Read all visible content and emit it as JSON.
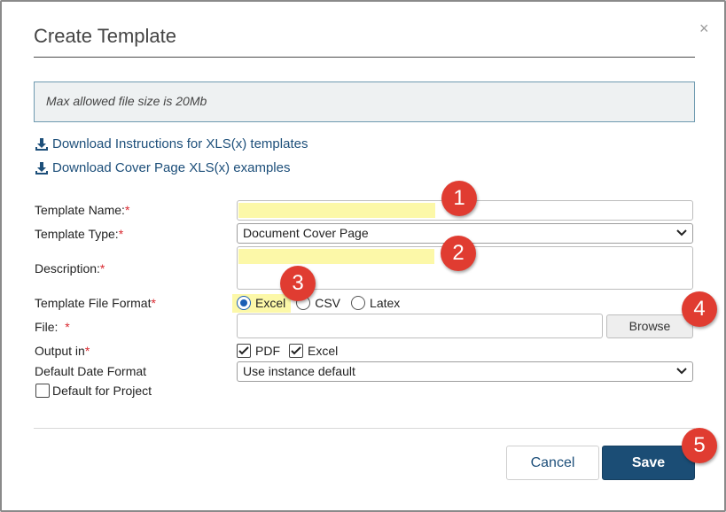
{
  "dialog": {
    "title": "Create Template",
    "close_glyph": "×"
  },
  "info": {
    "text": "Max allowed file size is 20Mb"
  },
  "links": [
    {
      "label": "Download Instructions for XLS(x) templates",
      "icon": "download-icon"
    },
    {
      "label": "Download Cover Page XLS(x) examples",
      "icon": "download-icon"
    }
  ],
  "form": {
    "template_name": {
      "label": "Template Name:",
      "required_mark": "*",
      "value": ""
    },
    "template_type": {
      "label": "Template Type:",
      "required_mark": "*",
      "selected": "Document Cover Page"
    },
    "description": {
      "label": "Description:",
      "required_mark": "*",
      "value": ""
    },
    "file_format": {
      "label": "Template File Format",
      "required_mark": "*",
      "options": [
        "Excel",
        "CSV",
        "Latex"
      ],
      "selected": "Excel"
    },
    "file": {
      "label": "File:",
      "required_mark": "*",
      "value": "",
      "browse_label": "Browse"
    },
    "output_in": {
      "label": "Output in",
      "required_mark": "*",
      "options": [
        {
          "label": "PDF",
          "checked": true
        },
        {
          "label": "Excel",
          "checked": true
        }
      ]
    },
    "date_format": {
      "label": "Default Date Format",
      "selected": "Use instance default"
    },
    "default_for_project": {
      "label": "Default for Project",
      "checked": false
    }
  },
  "footer": {
    "cancel_label": "Cancel",
    "save_label": "Save"
  },
  "annotations": [
    "1",
    "2",
    "3",
    "4",
    "5"
  ],
  "colors": {
    "accent": "#1b4d75",
    "link": "#1d4f7a",
    "required": "#d9282f",
    "highlight": "#fcf8a8",
    "badge": "#e03c31"
  }
}
